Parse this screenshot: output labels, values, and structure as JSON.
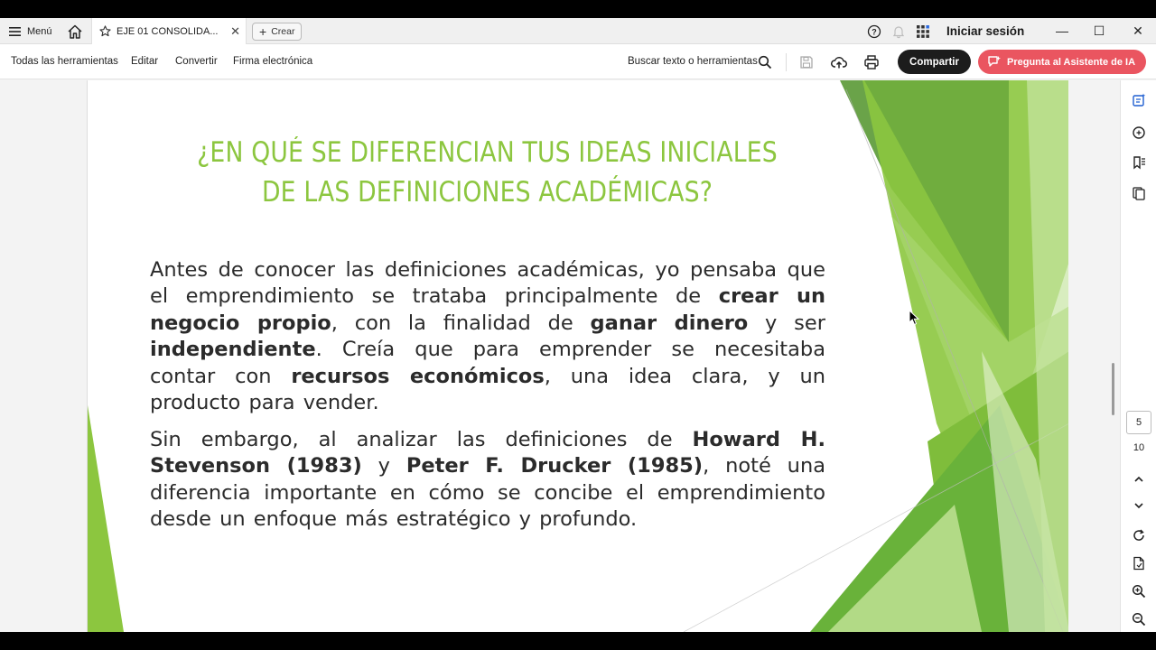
{
  "titlebar": {
    "menu_label": "Menú",
    "tab_title": "EJE 01 CONSOLIDA...",
    "crear_label": "Crear",
    "signin_label": "Iniciar sesión"
  },
  "toolbar": {
    "tools": [
      "Todas las herramientas",
      "Editar",
      "Convertir",
      "Firma electrónica"
    ],
    "search_label": "Buscar texto o herramientas",
    "share_label": "Compartir",
    "ai_label": "Pregunta al Asistente de IA"
  },
  "slide": {
    "title_line1": "¿EN QUÉ SE DIFERENCIAN TUS IDEAS INICIALES",
    "title_line2": "DE LAS DEFINICIONES ACADÉMICAS?",
    "p1": {
      "a": "Antes de conocer las definiciones académicas, yo pensaba que el emprendimiento se trataba principalmente de ",
      "b1": "crear un negocio propio",
      "c": ", con la finalidad de ",
      "b2": "ganar dinero",
      "d": " y ser ",
      "b3": "independiente",
      "e": ". Creía que para emprender se necesitaba contar con ",
      "b4": "recursos económicos",
      "f": ", una idea clara, y un producto para vender."
    },
    "p2": {
      "a": "Sin embargo, al analizar las definiciones de ",
      "b1": "Howard H. Stevenson (1983)",
      "c": " y ",
      "b2": "Peter F. Drucker (1985)",
      "d": ", noté una diferencia importante en cómo se concibe el emprendimiento desde un enfoque más estratégico y profundo."
    },
    "accent_color": "#8cc63f"
  },
  "pagination": {
    "current": "5",
    "total": "10"
  },
  "colors": {
    "share_bg": "#1c1c1c",
    "ai_bg": "#ea5560",
    "rail_icon": "#1f5fd1"
  }
}
